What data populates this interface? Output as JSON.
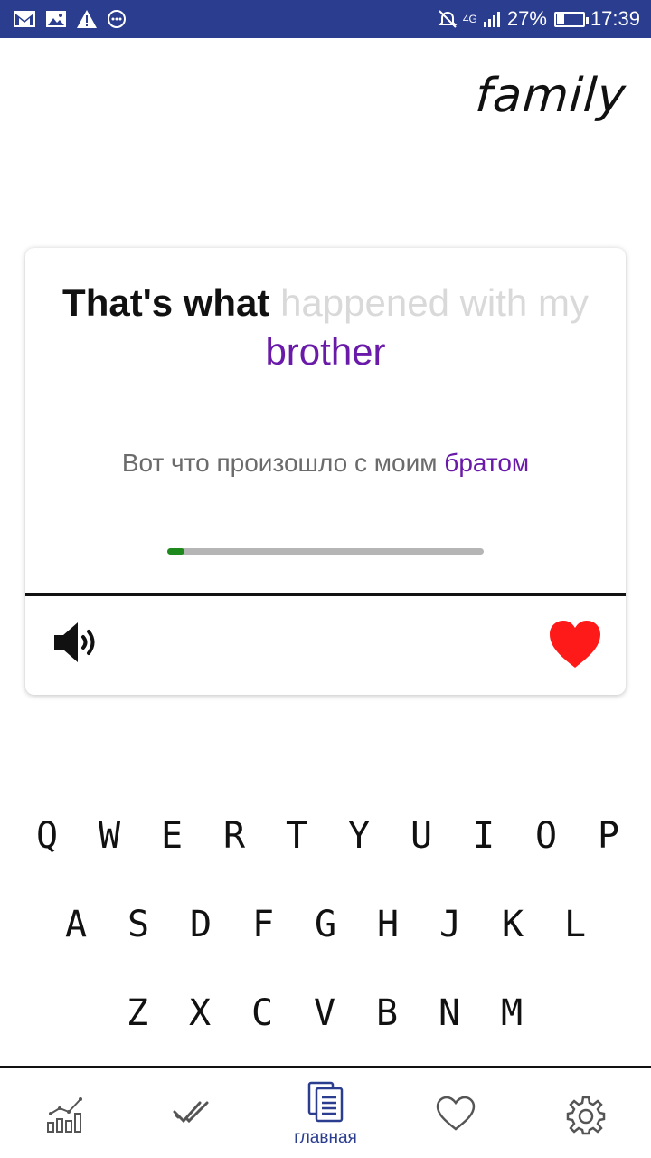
{
  "status_bar": {
    "network": "4G",
    "battery": "27%",
    "battery_level": 0.27,
    "time": "17:39",
    "icons": [
      "gmail-icon",
      "gallery-icon",
      "warning-icon",
      "more-icon",
      "mute-icon",
      "signal-icon",
      "battery-icon"
    ]
  },
  "topic": "family",
  "card": {
    "phrase_known": "That's what",
    "phrase_hint": "happened with my",
    "phrase_target": "brother",
    "translation_prefix": "Вот что произошло с моим",
    "translation_target": "братом",
    "progress": 0.055,
    "speaker_icon": "speaker-icon",
    "favorite_icon": "heart-icon"
  },
  "keyboard": {
    "rows": [
      [
        "Q",
        "W",
        "E",
        "R",
        "T",
        "Y",
        "U",
        "I",
        "O",
        "P"
      ],
      [
        "A",
        "S",
        "D",
        "F",
        "G",
        "H",
        "J",
        "K",
        "L"
      ],
      [
        "Z",
        "X",
        "C",
        "V",
        "B",
        "N",
        "M"
      ]
    ]
  },
  "bottom_nav": {
    "items": [
      {
        "icon": "stats-icon",
        "label": ""
      },
      {
        "icon": "checks-icon",
        "label": ""
      },
      {
        "icon": "cards-icon",
        "label": "главная",
        "active": true
      },
      {
        "icon": "heart-outline-icon",
        "label": ""
      },
      {
        "icon": "gear-icon",
        "label": ""
      }
    ]
  },
  "colors": {
    "status_bar": "#2a3d8f",
    "accent": "#6a1aa8",
    "hint": "#d9d9d9",
    "progress": "#1e8a1e",
    "heart": "#ff1a1a",
    "nav_active": "#2a3d8f"
  }
}
